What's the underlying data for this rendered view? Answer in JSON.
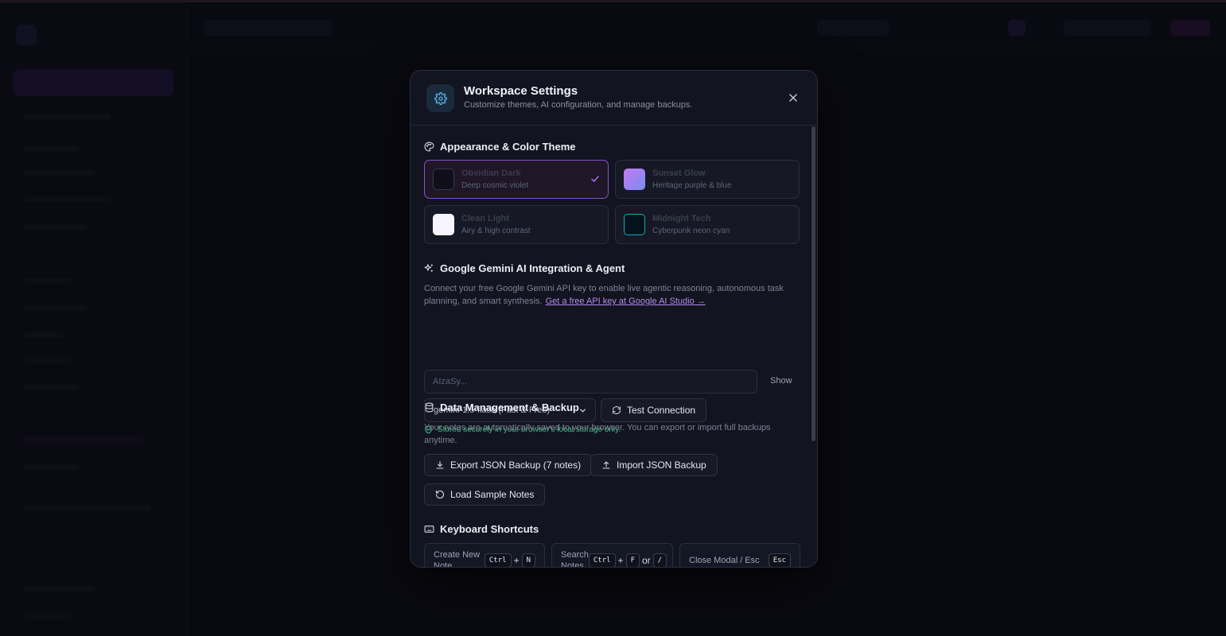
{
  "modal": {
    "title": "Workspace Settings",
    "subtitle": "Customize themes, AI configuration, and manage backups."
  },
  "appearance": {
    "title": "Appearance & Color Theme",
    "themes": [
      {
        "name": "Obsidian Dark",
        "desc": "Deep cosmic violet",
        "swatch": "#0f0f19",
        "selected": true
      },
      {
        "name": "Sunset Glow",
        "desc": "Heritage purple & blue",
        "swatch": "#a07af0",
        "selected": false
      },
      {
        "name": "Clean Light",
        "desc": "Airy & high contrast",
        "swatch": "#f7f4ff",
        "selected": false
      },
      {
        "name": "Midnight Tech",
        "desc": "Cyberpunk neon cyan",
        "swatch": "#04121c",
        "selected": false
      }
    ]
  },
  "gemini": {
    "title": "Google Gemini AI Integration & Agent",
    "description": "Connect your free Google Gemini API key to enable live agentic reasoning, autonomous task planning, and smart synthesis.",
    "link_text": "Get a free API key at Google AI Studio →",
    "api_placeholder": "AIzaSy...",
    "show_label": "Show",
    "model_selected": "gemini-1.5-flash (Fast & Free)",
    "test_label": "Test Connection",
    "stored_note": "Stored securely in your browser's local storage only."
  },
  "data_mgmt": {
    "title": "Data Management & Backup",
    "description": "Your notes are automatically saved to your browser. You can export or import full backups anytime.",
    "export_label": "Export JSON Backup (7 notes)",
    "import_label": "Import JSON Backup",
    "sample_label": "Load Sample Notes"
  },
  "shortcuts": {
    "title": "Keyboard Shortcuts",
    "items": [
      {
        "label": "Create New Note",
        "keys": [
          "Ctrl",
          "+",
          "N"
        ]
      },
      {
        "label": "Search Notes",
        "keys": [
          "Ctrl",
          "+",
          "F",
          "or",
          "/"
        ]
      },
      {
        "label": "Close Modal / Esc",
        "keys": [
          "Esc"
        ]
      }
    ]
  },
  "colors": {
    "accent": "#8a52c9",
    "success": "#3fbf8a",
    "link": "#b78ae8"
  }
}
